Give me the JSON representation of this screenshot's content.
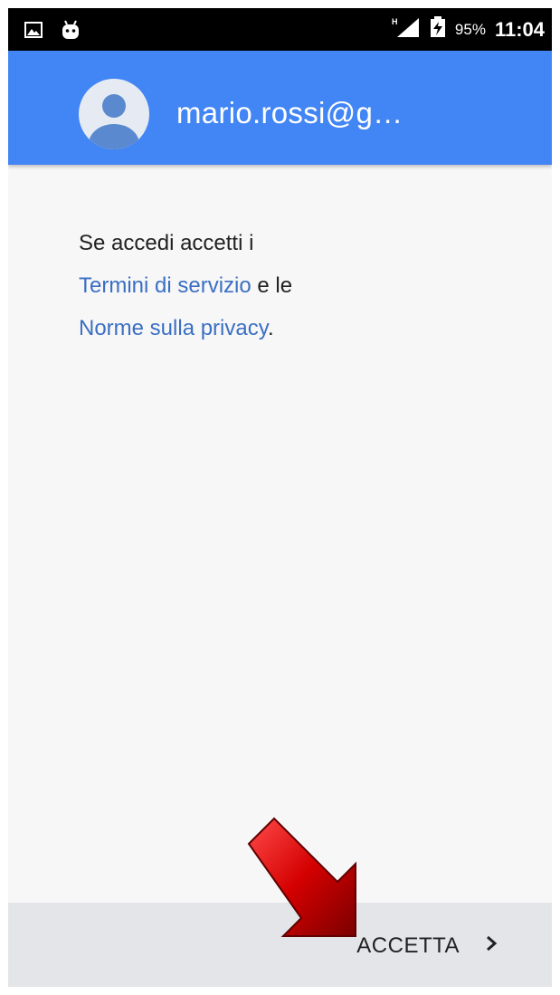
{
  "status_bar": {
    "battery_percent": "95%",
    "time": "11:04",
    "icons": [
      "gallery-icon",
      "android-icon",
      "signal-icon",
      "battery-charging-icon"
    ]
  },
  "header": {
    "email": "mario.rossi@g…",
    "avatar_icon": "account-avatar-icon",
    "background_color": "#4285f4"
  },
  "terms": {
    "line1": "Se accedi accetti i",
    "terms_link": "Termini di servizio",
    "joiner": " e le",
    "privacy_link": "Norme sulla privacy",
    "end": "."
  },
  "footer": {
    "accept_label": "ACCETTA",
    "accept_icon": "chevron-right-icon"
  },
  "annotation": {
    "arrow_icon": "red-arrow-icon"
  }
}
